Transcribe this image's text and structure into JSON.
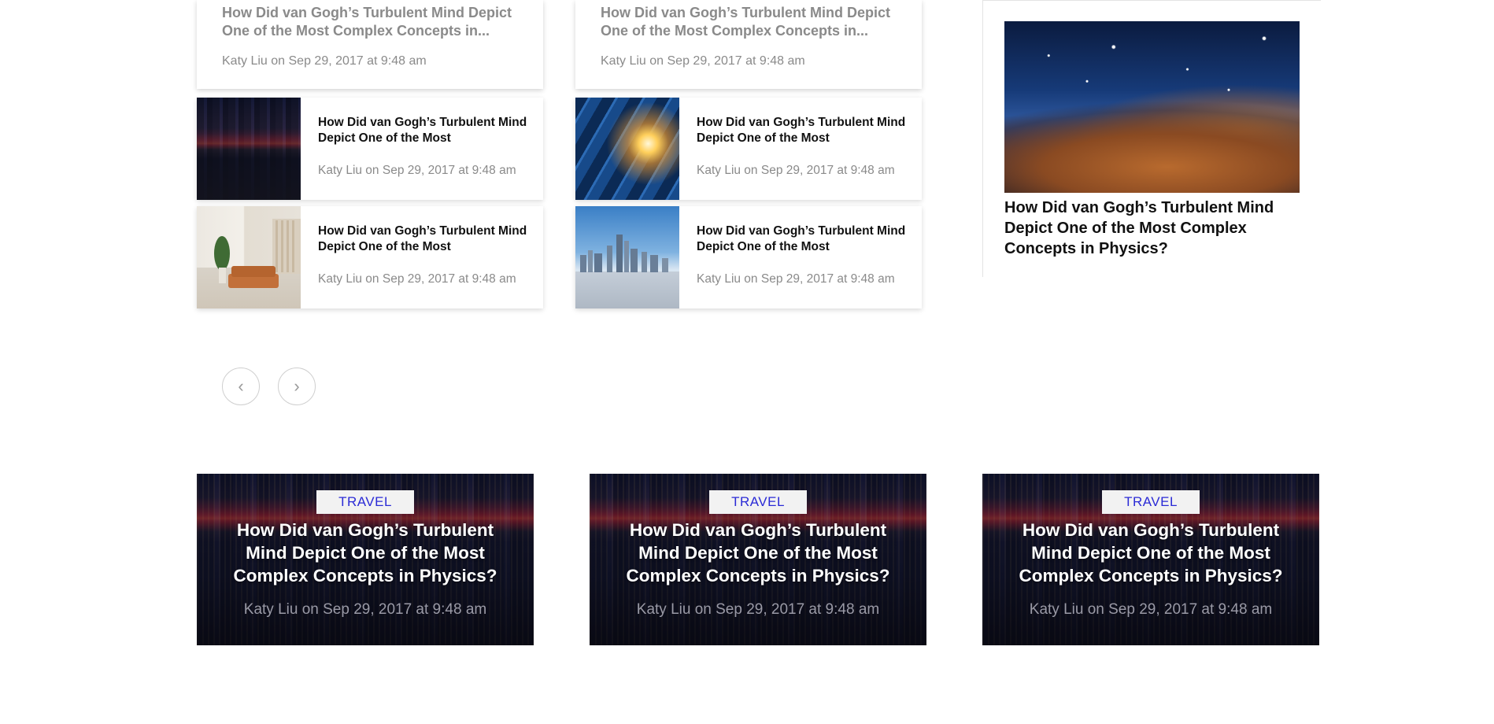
{
  "top_cards": [
    {
      "title": "How Did van Gogh’s Turbulent Mind Depict One of the Most Complex Concepts in...",
      "meta": "Katy Liu on Sep 29, 2017 at 9:48 am"
    },
    {
      "title": "How Did van Gogh’s Turbulent Mind Depict One of the Most Complex Concepts in...",
      "meta": "Katy Liu on Sep 29, 2017 at 9:48 am"
    }
  ],
  "mini_cards": [
    {
      "image": "city-dusk-image",
      "title": "How Did van Gogh’s Turbulent Mind Depict One of the Most",
      "meta": "Katy Liu on Sep 29, 2017 at 9:48 am"
    },
    {
      "image": "glass-building-image",
      "title": "How Did van Gogh’s Turbulent Mind Depict One of the Most",
      "meta": "Katy Liu on Sep 29, 2017 at 9:48 am"
    },
    {
      "image": "living-room-image",
      "title": "How Did van Gogh’s Turbulent Mind Depict One of the Most",
      "meta": "Katy Liu on Sep 29, 2017 at 9:48 am"
    },
    {
      "image": "skyline-image",
      "title": "How Did van Gogh’s Turbulent Mind Depict One of the Most",
      "meta": "Katy Liu on Sep 29, 2017 at 9:48 am"
    }
  ],
  "sidebar_feature": {
    "image": "nebula-image",
    "title": "How Did van Gogh’s Turbulent Mind Depict One of the Most Complex Concepts in Physics?"
  },
  "pager": {
    "prev_icon": "chevron-left-icon",
    "prev_glyph": "‹",
    "next_icon": "chevron-right-icon",
    "next_glyph": "›"
  },
  "hero_cards": [
    {
      "tag": "TRAVEL",
      "title": "How Did van Gogh’s Turbulent Mind Depict One of the Most Complex Concepts in Physics?",
      "meta": "Katy Liu on Sep 29, 2017 at 9:48 am"
    },
    {
      "tag": "TRAVEL",
      "title": "How Did van Gogh’s Turbulent Mind Depict One of the Most Complex Concepts in Physics?",
      "meta": "Katy Liu on Sep 29, 2017 at 9:48 am"
    },
    {
      "tag": "TRAVEL",
      "title": "How Did van Gogh’s Turbulent Mind Depict One of the Most Complex Concepts in Physics?",
      "meta": "Katy Liu on Sep 29, 2017 at 9:48 am"
    }
  ],
  "colors": {
    "tag_text": "#2b2bd6",
    "meta_gray": "#8a8a8a",
    "title_dark": "#111111"
  }
}
